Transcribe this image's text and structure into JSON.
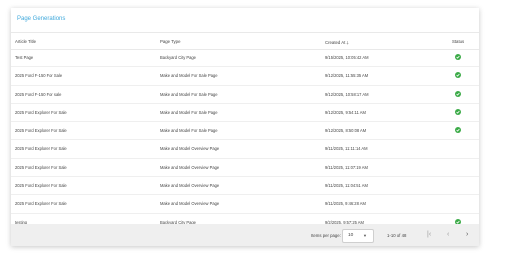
{
  "card": {
    "title": "Page Generations"
  },
  "columns": {
    "article_title": "Article Title",
    "page_type": "Page Type",
    "created_at": "Created At",
    "status": "Status"
  },
  "rows": [
    {
      "title": "Test Page",
      "type": "Backyard City Page",
      "created": "9/15/2025, 10:05:42 AM",
      "status": "success"
    },
    {
      "title": "2025 Ford F-150 For Sale",
      "type": "Make and Model For Sale Page",
      "created": "9/12/2025, 11:55:35 AM",
      "status": "success"
    },
    {
      "title": "2025 Ford F-150 For sale",
      "type": "Make and Model For Sale Page",
      "created": "9/12/2025, 10:58:17 AM",
      "status": "success"
    },
    {
      "title": "2025 Ford Explorer For Sale",
      "type": "Make and Model For Sale Page",
      "created": "9/12/2025, 9:54:11 AM",
      "status": "success"
    },
    {
      "title": "2025 Ford Explorer For Sale",
      "type": "Make and Model For Sale Page",
      "created": "9/12/2025, 8:50:08 AM",
      "status": "success"
    },
    {
      "title": "2025 Ford Explorer For Sale",
      "type": "Make and Model Overview Page",
      "created": "9/11/2025, 11:11:14 AM",
      "status": "none"
    },
    {
      "title": "2025 Ford Explorer For Sale",
      "type": "Make and Model Overview Page",
      "created": "9/11/2025, 11:07:19 AM",
      "status": "none"
    },
    {
      "title": "2025 Ford Explorer For Sale",
      "type": "Make and Model Overview Page",
      "created": "9/11/2025, 11:04:51 AM",
      "status": "none"
    },
    {
      "title": "2025 Ford Explorer For Sale",
      "type": "Make and Model Overview Page",
      "created": "9/11/2025, 9:46:28 AM",
      "status": "none"
    },
    {
      "title": "testing",
      "type": "Backyard City Page",
      "created": "9/2/2025, 9:57:25 AM",
      "status": "success"
    }
  ],
  "pagination": {
    "items_per_page_label": "Items per page:",
    "items_per_page_value": "10",
    "range_text": "1-10 of 48",
    "first_icon": "first-page-icon",
    "prev_icon": "chevron-left-icon",
    "next_icon": "chevron-right-icon",
    "last_icon": "last-page-icon"
  },
  "colors": {
    "title": "#41a9dc",
    "success": "#3cab48",
    "footer_bg": "#efefef"
  }
}
